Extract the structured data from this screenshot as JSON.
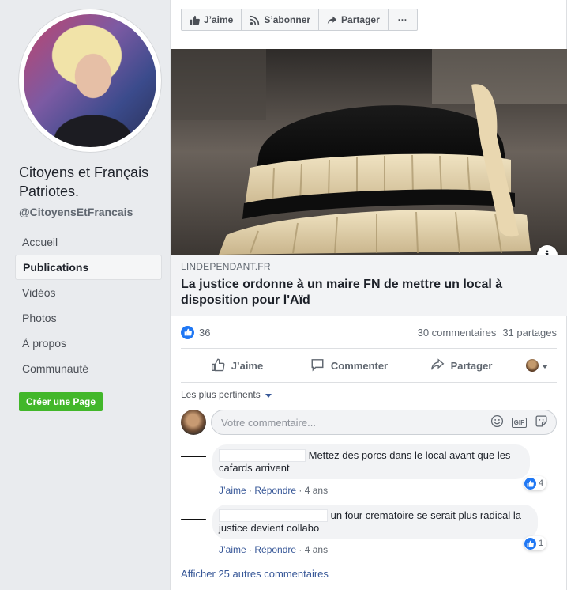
{
  "sidebar": {
    "page_name": "Citoyens et Français Patriotes.",
    "page_handle": "@CitoyensEtFrancais",
    "nav": [
      "Accueil",
      "Publications",
      "Vidéos",
      "Photos",
      "À propos",
      "Communauté"
    ],
    "active_index": 1,
    "create_page_label": "Créer une Page"
  },
  "action_bar": {
    "like": "J’aime",
    "follow": "S’abonner",
    "share": "Partager",
    "more": "···"
  },
  "article": {
    "domain": "LINDEPENDANT.FR",
    "title": "La justice ordonne à un maire FN de mettre un local à disposition pour l'Aïd"
  },
  "stats": {
    "likes": "36",
    "comments": "30 commentaires",
    "shares": "31 partages"
  },
  "reactions": {
    "like": "J’aime",
    "comment": "Commenter",
    "share": "Partager"
  },
  "comments_section": {
    "sort_label": "Les plus pertinents",
    "input_placeholder": "Votre commentaire...",
    "comments": [
      {
        "text_line1": "Mettez des porcs dans le local avant que les",
        "text_line2": "cafards arrivent",
        "like": "J’aime",
        "reply": "Répondre",
        "time": "4 ans",
        "reactions": "4"
      },
      {
        "text_line1": "un four crematoire se serait plus radical la",
        "text_line2": "justice devient collabo",
        "like": "J’aime",
        "reply": "Répondre",
        "time": "4 ans",
        "reactions": "1"
      }
    ],
    "more_label": "Afficher 25 autres commentaires"
  },
  "colors": {
    "facebook_blue": "#385898",
    "like_blue": "#2078f4",
    "create_green": "#42b72a",
    "background": "#e9ebee"
  }
}
